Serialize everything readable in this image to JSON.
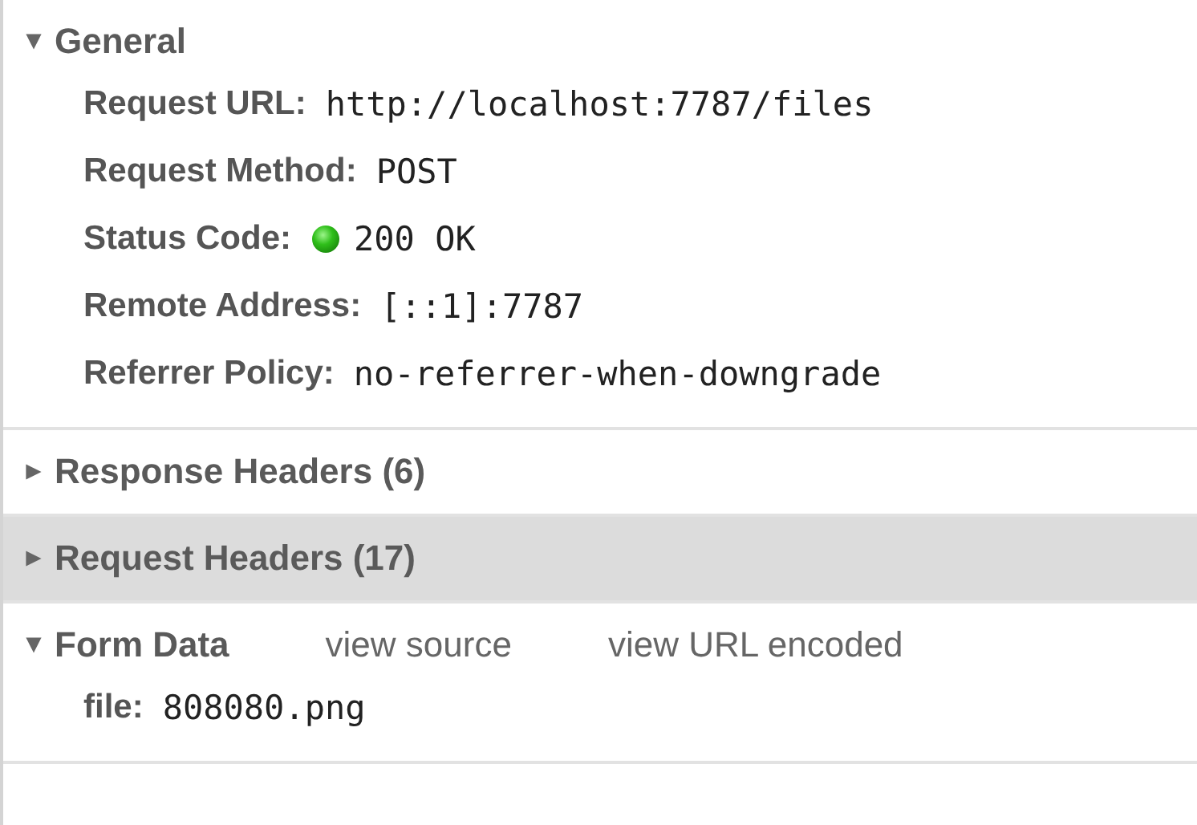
{
  "sections": [
    {
      "title": "General",
      "expanded": true,
      "selected": false,
      "rows": [
        {
          "kind": "plain",
          "key": "Request URL:",
          "value": "http://localhost:7787/files"
        },
        {
          "kind": "plain",
          "key": "Request Method:",
          "value": "POST"
        },
        {
          "kind": "status",
          "key": "Status Code:",
          "value": "200 OK"
        },
        {
          "kind": "plain",
          "key": "Remote Address:",
          "value": "[::1]:7787"
        },
        {
          "kind": "plain",
          "key": "Referrer Policy:",
          "value": "no-referrer-when-downgrade"
        }
      ]
    },
    {
      "title": "Response Headers (6)",
      "expanded": false,
      "selected": false
    },
    {
      "title": "Request Headers (17)",
      "expanded": false,
      "selected": true
    },
    {
      "title": "Form Data",
      "expanded": true,
      "selected": false,
      "links": [
        "view source",
        "view URL encoded"
      ],
      "rows": [
        {
          "kind": "plain",
          "key": "file:",
          "value": "808080.png"
        }
      ]
    }
  ]
}
